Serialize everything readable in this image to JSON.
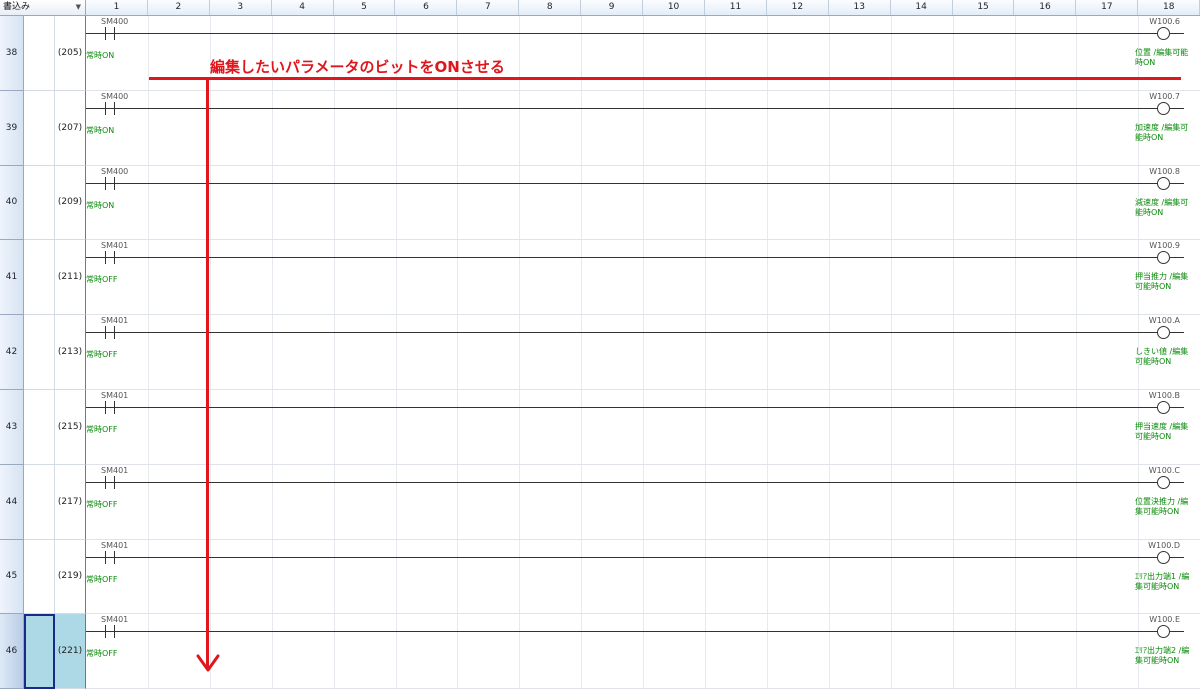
{
  "header": {
    "mode_label": "書込み",
    "columns": [
      "1",
      "2",
      "3",
      "4",
      "5",
      "6",
      "7",
      "8",
      "9",
      "10",
      "11",
      "12",
      "13",
      "14",
      "15",
      "16",
      "17",
      "18"
    ]
  },
  "rungs": [
    {
      "row": "38",
      "step": "(205)",
      "contact": "SM400",
      "contact_comment": "常時ON",
      "coil": "W100.6",
      "coil_comment": "位置 /編集可能時ON"
    },
    {
      "row": "39",
      "step": "(207)",
      "contact": "SM400",
      "contact_comment": "常時ON",
      "coil": "W100.7",
      "coil_comment": "加速度 /編集可能時ON"
    },
    {
      "row": "40",
      "step": "(209)",
      "contact": "SM400",
      "contact_comment": "常時ON",
      "coil": "W100.8",
      "coil_comment": "減速度 /編集可能時ON"
    },
    {
      "row": "41",
      "step": "(211)",
      "contact": "SM401",
      "contact_comment": "常時OFF",
      "coil": "W100.9",
      "coil_comment": "押当推力 /編集可能時ON"
    },
    {
      "row": "42",
      "step": "(213)",
      "contact": "SM401",
      "contact_comment": "常時OFF",
      "coil": "W100.A",
      "coil_comment": "しきい値 /編集可能時ON"
    },
    {
      "row": "43",
      "step": "(215)",
      "contact": "SM401",
      "contact_comment": "常時OFF",
      "coil": "W100.B",
      "coil_comment": "押当速度 /編集可能時ON"
    },
    {
      "row": "44",
      "step": "(217)",
      "contact": "SM401",
      "contact_comment": "常時OFF",
      "coil": "W100.C",
      "coil_comment": "位置決推力 /編集可能時ON"
    },
    {
      "row": "45",
      "step": "(219)",
      "contact": "SM401",
      "contact_comment": "常時OFF",
      "coil": "W100.D",
      "coil_comment": "ｴﾘｱ出力端1 /編集可能時ON"
    },
    {
      "row": "46",
      "step": "(221)",
      "contact": "SM401",
      "contact_comment": "常時OFF",
      "coil": "W100.E",
      "coil_comment": "ｴﾘｱ出力端2 /編集可能時ON"
    }
  ],
  "annotation": {
    "text": "編集したいパラメータのビットをONさせる",
    "color": "#e0161d"
  },
  "colors": {
    "comment": "#0a8a0a",
    "selection": "#add8e6"
  }
}
